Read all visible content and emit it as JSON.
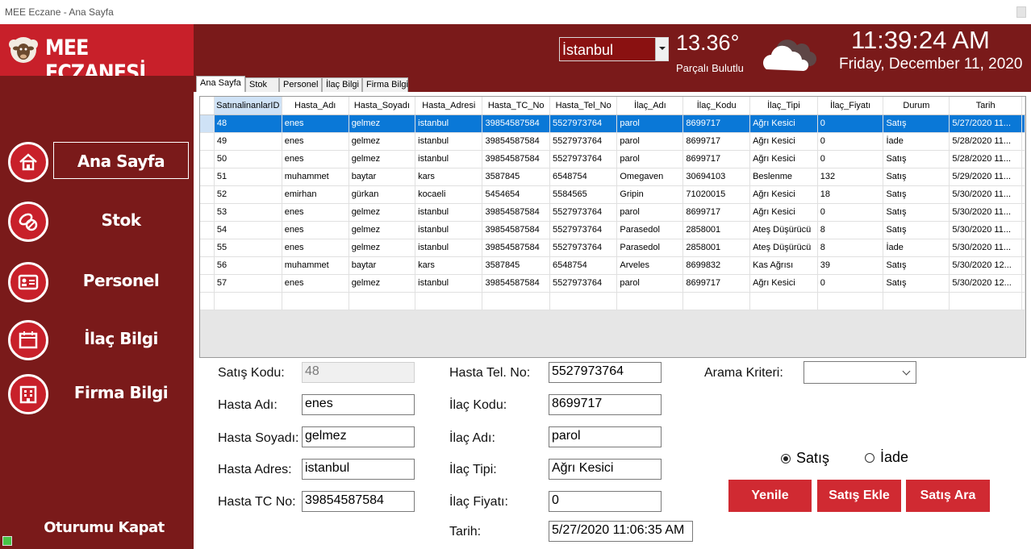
{
  "window": {
    "title": "MEE Eczane - Ana Sayfa"
  },
  "header": {
    "logo_text": "MEE ECZANESİ",
    "city": "İstanbul",
    "temperature": "13.36°",
    "weather_desc": "Parçalı Bulutlu",
    "time": "11:39:24 AM",
    "date": "Friday, December 11, 2020"
  },
  "sidebar": {
    "items": [
      {
        "label": "Ana Sayfa",
        "icon": "home-icon"
      },
      {
        "label": "Stok",
        "icon": "pills-icon"
      },
      {
        "label": "Personel",
        "icon": "id-card-icon"
      },
      {
        "label": "İlaç Bilgi",
        "icon": "calendar-icon"
      },
      {
        "label": "Firma Bilgi",
        "icon": "building-icon"
      }
    ],
    "logout": "Oturumu Kapat"
  },
  "tabs": [
    "Ana Sayfa",
    "Stok",
    "Personel",
    "İlaç Bilgi",
    "Firma Bilgi"
  ],
  "grid": {
    "columns": [
      "SatınalinanlarID",
      "Hasta_Adı",
      "Hasta_Soyadı",
      "Hasta_Adresi",
      "Hasta_TC_No",
      "Hasta_Tel_No",
      "İlaç_Adı",
      "İlaç_Kodu",
      "İlaç_Tipi",
      "İlaç_Fiyatı",
      "Durum",
      "Tarih"
    ],
    "rows": [
      [
        "48",
        "enes",
        "gelmez",
        "istanbul",
        "39854587584",
        "5527973764",
        "parol",
        "8699717",
        "Ağrı Kesici",
        "0",
        "Satış",
        "5/27/2020 11..."
      ],
      [
        "49",
        "enes",
        "gelmez",
        "istanbul",
        "39854587584",
        "5527973764",
        "parol",
        "8699717",
        "Ağrı Kesici",
        "0",
        "İade",
        "5/28/2020 11..."
      ],
      [
        "50",
        "enes",
        "gelmez",
        "istanbul",
        "39854587584",
        "5527973764",
        "parol",
        "8699717",
        "Ağrı Kesici",
        "0",
        "Satış",
        "5/28/2020 11..."
      ],
      [
        "51",
        "muhammet",
        "baytar",
        "kars",
        "3587845",
        "6548754",
        "Omegaven",
        "30694103",
        "Beslenme",
        "132",
        "Satış",
        "5/29/2020 11..."
      ],
      [
        "52",
        "emirhan",
        "gürkan",
        "kocaeli",
        "5454654",
        "5584565",
        "Gripin",
        "71020015",
        "Ağrı Kesici",
        "18",
        "Satış",
        "5/30/2020 11..."
      ],
      [
        "53",
        "enes",
        "gelmez",
        "istanbul",
        "39854587584",
        "5527973764",
        "parol",
        "8699717",
        "Ağrı Kesici",
        "0",
        "Satış",
        "5/30/2020 11..."
      ],
      [
        "54",
        "enes",
        "gelmez",
        "istanbul",
        "39854587584",
        "5527973764",
        "Parasedol",
        "2858001",
        "Ateş Düşürücü",
        "8",
        "Satış",
        "5/30/2020 11..."
      ],
      [
        "55",
        "enes",
        "gelmez",
        "istanbul",
        "39854587584",
        "5527973764",
        "Parasedol",
        "2858001",
        "Ateş Düşürücü",
        "8",
        "İade",
        "5/30/2020 11..."
      ],
      [
        "56",
        "muhammet",
        "baytar",
        "kars",
        "3587845",
        "6548754",
        "Arveles",
        "8699832",
        "Kas Ağrısı",
        "39",
        "Satış",
        "5/30/2020 12..."
      ],
      [
        "57",
        "enes",
        "gelmez",
        "istanbul",
        "39854587584",
        "5527973764",
        "parol",
        "8699717",
        "Ağrı Kesici",
        "0",
        "Satış",
        "5/30/2020 12..."
      ]
    ]
  },
  "form": {
    "satis_kodu_label": "Satış Kodu:",
    "satis_kodu": "48",
    "hasta_adi_label": "Hasta Adı:",
    "hasta_adi": "enes",
    "hasta_soyadi_label": "Hasta Soyadı:",
    "hasta_soyadi": "gelmez",
    "hasta_adres_label": "Hasta Adres:",
    "hasta_adres": "istanbul",
    "hasta_tc_label": "Hasta TC No:",
    "hasta_tc": "39854587584",
    "hasta_tel_label": "Hasta Tel. No:",
    "hasta_tel": "5527973764",
    "ilac_kodu_label": "İlaç Kodu:",
    "ilac_kodu": "8699717",
    "ilac_adi_label": "İlaç Adı:",
    "ilac_adi": "parol",
    "ilac_tipi_label": "İlaç Tipi:",
    "ilac_tipi": "Ağrı Kesici",
    "ilac_fiyati_label": "İlaç Fiyatı:",
    "ilac_fiyati": "0",
    "tarih_label": "Tarih:",
    "tarih": "5/27/2020 11:06:35 AM",
    "arama_kriteri_label": "Arama Kriteri:",
    "arama_kriteri": ""
  },
  "radios": {
    "satis": "Satış",
    "iade": "İade",
    "selected": "satis"
  },
  "buttons": {
    "yenile": "Yenile",
    "satis_ekle": "Satış Ekle",
    "satis_ara": "Satış Ara"
  },
  "colors": {
    "header": "#7a1a1a",
    "accent": "#c8202a",
    "button": "#d02a32",
    "selection": "#0a78d7"
  }
}
